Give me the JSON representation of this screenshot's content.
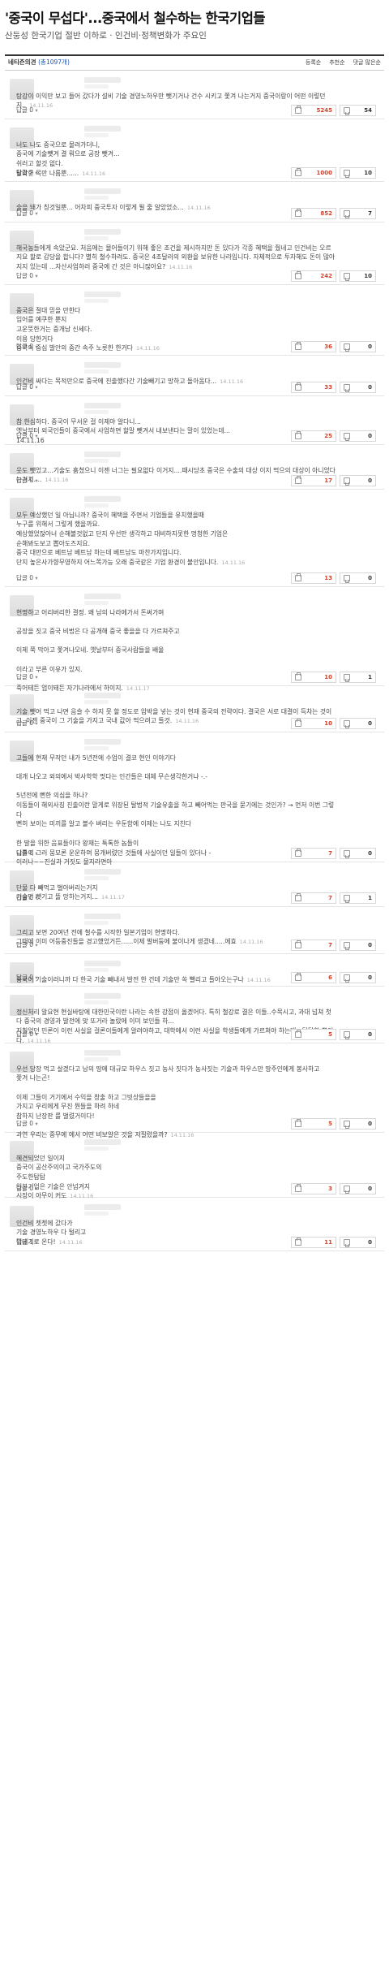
{
  "article": {
    "title": "'중국이 무섭다'...중국에서 철수하는 한국기업들",
    "subtitle": "산둥성 한국기업 절반 이하로 · 인건비·정책변화가 주요인"
  },
  "toolbar": {
    "label": "네티즌의견",
    "count": "(총1097개)",
    "sort_options": [
      "등록순",
      "추천순",
      "댓글 많은순"
    ],
    "selected_sort": "등록순"
  },
  "reply_label": "답글",
  "colors": {
    "accent_blue": "#1a58b7",
    "up_red": "#d1422b"
  },
  "icons": [
    "thumbs-up-icon",
    "thumbs-down-icon",
    "chevron-down-icon"
  ],
  "comments": [
    {
      "lines": [
        "탕강이 이익만 보고 들어 갔다가 설비 기술 경영노하우만 뺏기거나 건수 시키고 쫓겨 나는거지 중국이랑이 어떤 이렇던지.."
      ],
      "time": "14.11.16",
      "replies": "0",
      "up": "5245",
      "down": "54"
    },
    {
      "lines": [
        "너도 나도 중국으로 몰려가더니,",
        "중국에 기술뺏겨 결 뭐으로 공장 뺏겨...",
        "쉬러고 할것 없다.",
        "탈락한 목만 나름뿐......"
      ],
      "time": "14.11.16",
      "replies": "2",
      "up": "1000",
      "down": "10"
    },
    {
      "lines": [
        "술을 돼가 칭것일뿐... 어차피 중국투자 이렇게 될 줄 알았었소..."
      ],
      "time": "14.11.16",
      "replies": "0",
      "up": "852",
      "down": "7"
    },
    {
      "lines": [
        "해국농들에게 속았군요. 처음에는 몰어들이기 위해 좋은 조건을 제시하지만 돈 있다가 각종 혜택을 줬네고 인건비는 오르지요 할로 감당을 합니다? 별히 철수하려도. 중국은 4조달러의 외환을 보유한 나라입니다. 자체적으로 투자해도 돈이 많아지지 있는데 ...자산사업하러 중국에 간 것은 아니잖아요?"
      ],
      "time": "14.11.16",
      "replies": "0",
      "up": "242",
      "down": "10"
    },
    {
      "lines": [
        "중국은 절대 믿을 만한다",
        "입어를 예쿠한 뿐지",
        "고운뜻한거는 중개남 신세다.",
        "이용 당한거다",
        "중국의 중심 발안의 중간 속주 노릇한 한거다"
      ],
      "time": "14.11.16",
      "replies": "0",
      "up": "36",
      "down": "0"
    },
    {
      "lines": [
        "인건비 싸다는 목적만으로 중국에 진출했다간 기술빼기고 망하고 돌아옴다..."
      ],
      "time": "14.11.16",
      "replies": "0",
      "up": "33",
      "down": "0"
    },
    {
      "lines": [
        "참 한심하다. 중국이 무서운 걸 이제야 알다니...",
        "옛날부터 외국인들이 중국에서 사업하면 할말 뺏겨서 내보낸다는 말이 있었는데...",
        "14.11.16"
      ],
      "time": "",
      "replies": "0",
      "up": "25",
      "down": "0"
    },
    {
      "lines": [
        "웃도 뺏었고...기술도 훔쳤으니 이젠 너그는 필요없다 이거지....때시당초 중국은 수출의 대상 이지 먹으의 대상이 아니었다는거지...."
      ],
      "time": "14.11.16",
      "replies": "0",
      "up": "17",
      "down": "0"
    },
    {
      "lines": [
        "모두 예상했던 일 아닙니까? 중국이 혜택을 주면서 기업들을 유치했을때",
        "누구를 위해서 그렇게 했을까요.",
        "예상했었잖아너 순해볼것없고 단지 우선만 생각하고 대비하지못한 멍청한 기업은",
        "순해봐도보고 뽑아도즈지요.",
        "중국 대만으로 베트남 베트남 하는데 베트남도 마찬가지입니다.",
        "단지 높은사가향무영하지 어느쪽가능 오래 중국같은 기업 환경이 불안입니다."
      ],
      "time": "14.11.16",
      "replies": "0",
      "up": "13",
      "down": "0"
    },
    {
      "lines": [
        "현명하고 어리버리한 결정. 왜 남의 나라에가서 돈써가며",
        "",
        "공장을 짓고 중국 비법은 다 공개해 중국 좋을을 다 가르쳐주고",
        "",
        "이제 쭉 막아고 쫓겨나오네. 옛날부터 중국사람들을 배울",
        "",
        "이라고 부른 이유가 있지.",
        "",
        "죽어테든 업이돼든 자기나라에서 하이지."
      ],
      "time": "14.11.17",
      "replies": "0",
      "up": "10",
      "down": "1"
    },
    {
      "lines": [
        "기술 뺏어 먹고 나면 음슬 수 하지 못 할 정도로 압박을 넣는 것이 현재 중국의 전략이다. 결국은 서로 대결이 득차는 것이고, 이젠 중국이 그 기술을 가지고 국내 값아 먹으려고 들것."
      ],
      "time": "14.11.16",
      "replies": "0",
      "up": "10",
      "down": "0"
    },
    {
      "lines": [
        "고들에 현재 무작던 내가 5년전에 수업이 결코 현인 이야기다",
        "",
        "대개 나오고 외의에서 박사학학 멋다는 인간들은 대체 무슨생각한거냐 -.-",
        "",
        "5년전에 뻔한 의심을 하나?",
        "이동들이 해외사징 진출이란 말게로 위장된 탈법적 기술유출을 하고 빼어먹는 판국을 묻기에는 것인가? → 먼저 이번 그렇다",
        "뻔히 보이는 미끼를 알고 볼수 벼리는 우둔함에 이제는 나도 지친다",
        "",
        "한 발을 위한 음표들이다 왕재는 툭톡한 놈들이",
        "니틀이 그러 뭄모론 운운하며 뭉개버렸던 것들에 사실이던 일들이 있더나 -",
        "이러나~~진실과 거짓도 몰지라면아"
      ],
      "time": "",
      "replies": "0",
      "up": "7",
      "down": "0"
    },
    {
      "lines": [
        "단물 다 빼먹고 벌아버리는거지",
        "기술만 뺏기고 뜰 망하는거지..."
      ],
      "time": "14.11.17",
      "replies": "0",
      "up": "7",
      "down": "1"
    },
    {
      "lines": [
        "그리고 보면 20여년 전에 철수를 시작한 일본기업이 현명하다.",
        "그때에 이미 어등중진들을 경고했었거든......이제 발버둥에 불이나게 생겼네.....에효"
      ],
      "time": "14.11.16",
      "replies": "0",
      "up": "7",
      "down": "0"
    },
    {
      "lines": [
        "중국이 기술이러니까 다 한국 기술 빼내서 발전 한 건데 기술만 쏙 빨리고 들아오는구나"
      ],
      "time": "14.11.16",
      "replies": "0",
      "up": "6",
      "down": "0"
    },
    {
      "lines": [
        "정신처리 알요현 현실바탕에 대한민국이란 나라는 속한 강점이 옳겠어다. 특히 철강로 결은 이들..수목시고, 과대 넘쳐 첫다 중국의 경영과 발전에 맞 또거라 놀랐에 이미 보인들 하...",
        "지칠었던 민론이 이런 사실을 걸론이들에게 알려야하고, 대학에서 이런 사실을 학생들에게 가르쳐야 하는데...답답할 뿐이다."
      ],
      "time": "14.11.16",
      "replies": "0",
      "up": "5",
      "down": "0"
    },
    {
      "lines": [
        "우선 당장 먹고 살겠다고 남의 땅에 대규모 하우스 짓고 농사 짓다가 농사짓는 기술과 하우스만 땅주인에게 봉사하고",
        "쫓겨 나는곤!",
        "",
        "이제 그들이 거기에서 수익을 창출 하고 그빗상들을을",
        "가지고 우리에게 무진 뭔들을 하려 하네",
        "참하지 난장판 를 벌렸거이다!",
        "",
        "과연 우리는 중무에 에서 어떤 비보알은 것을 저질렀을까?"
      ],
      "time": "14.11.16",
      "replies": "0",
      "up": "5",
      "down": "0"
    },
    {
      "lines": [
        "혜견되었던 일이지",
        "중국이 공산주의이고 국가주도의",
        "주도한탐탐",
        "일본기업은 기술은 안넘겨지",
        "시장이 아무이 커도"
      ],
      "time": "14.11.16",
      "replies": "0",
      "up": "3",
      "down": "0"
    },
    {
      "lines": [
        "인건비 쳇쳇에 갔다가",
        "기술 경영노하우 다 털리고",
        "껍데기로 온다!"
      ],
      "time": "14.11.16",
      "replies": "1",
      "up": "11",
      "down": "0"
    }
  ]
}
